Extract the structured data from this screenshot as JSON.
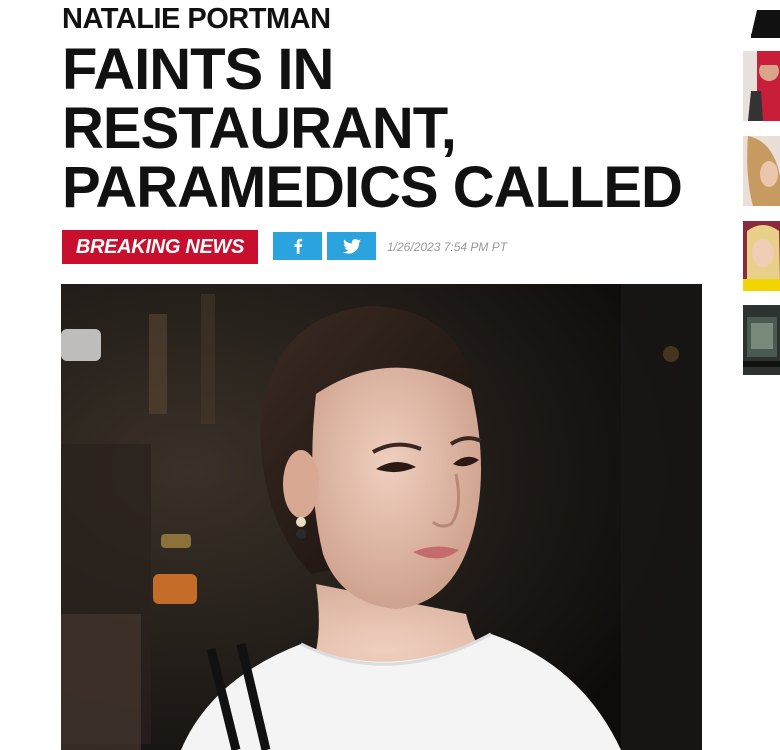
{
  "article": {
    "kicker": "NATALIE PORTMAN",
    "headline_lines": [
      "FAINTS IN",
      "RESTAURANT,",
      "PARAMEDICS CALLED"
    ],
    "badge": "BREAKING NEWS",
    "timestamp": "1/26/2023 7:54 PM PT"
  },
  "share": {
    "facebook_icon": "facebook-icon",
    "twitter_icon": "twitter-icon"
  },
  "colors": {
    "badge_red": "#c8102e",
    "share_blue": "#2aa3df",
    "headline": "#111111",
    "timestamp": "#999999"
  },
  "sidebar": {
    "thumbnails": [
      "thumbnail-1",
      "thumbnail-2",
      "thumbnail-3",
      "thumbnail-4"
    ]
  }
}
